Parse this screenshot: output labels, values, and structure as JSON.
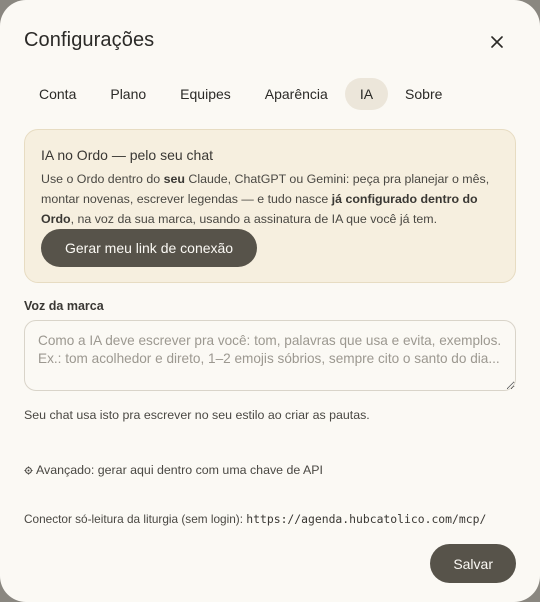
{
  "dialog": {
    "title": "Configurações",
    "close_icon": "close-icon"
  },
  "tabs": [
    {
      "label": "Conta",
      "active": false
    },
    {
      "label": "Plano",
      "active": false
    },
    {
      "label": "Equipes",
      "active": false
    },
    {
      "label": "Aparência",
      "active": false
    },
    {
      "label": "IA",
      "active": true
    },
    {
      "label": "Sobre",
      "active": false
    }
  ],
  "ai_card": {
    "title": "IA no Ordo — pelo seu chat",
    "text_1": "Use o Ordo dentro do ",
    "text_bold_1": "seu",
    "text_2": " Claude, ChatGPT ou Gemini: peça pra planejar o mês, montar novenas, escrever legendas — e tudo nasce ",
    "text_bold_2": "já configurado dentro do Ordo",
    "text_3": ", na voz da sua marca, usando a assinatura de IA que você já tem.",
    "button_label": "Gerar meu link de conexão"
  },
  "brand_voice": {
    "label": "Voz da marca",
    "value": "",
    "placeholder": "Como a IA deve escrever pra você: tom, palavras que usa e evita, exemplos. Ex.: tom acolhedor e direto, 1–2 emojis sóbrios, sempre cito o santo do dia...",
    "hint": "Seu chat usa isto pra escrever no seu estilo ao criar as pautas."
  },
  "advanced": {
    "icon": "gear-icon",
    "label": "Avançado: gerar aqui dentro com uma chave de API"
  },
  "connector": {
    "text": "Conector só-leitura da liturgia (sem login): ",
    "url": "https://agenda.hubcatolico.com/mcp/"
  },
  "footer": {
    "save_label": "Salvar"
  },
  "colors": {
    "background": "#fbf9f4",
    "card_background": "#f6efdf",
    "button": "#57534a",
    "active_tab": "#ece6da"
  }
}
